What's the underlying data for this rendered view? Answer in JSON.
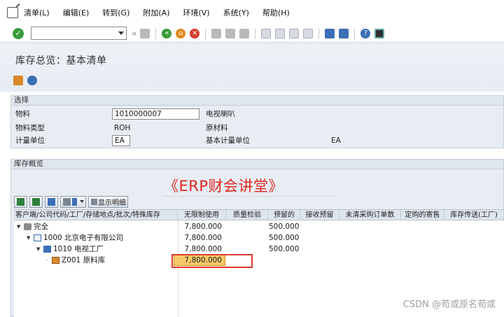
{
  "menu": {
    "items": [
      "清单(L)",
      "编辑(E)",
      "转到(G)",
      "附加(A)",
      "环境(V)",
      "系统(Y)",
      "帮助(H)"
    ]
  },
  "toolbar": {
    "command_value": "",
    "icons": [
      "save-icon",
      "back-icon",
      "exit-icon",
      "cancel-icon",
      "print-icon",
      "find-icon",
      "find-next-icon",
      "first-page-icon",
      "prev-page-icon",
      "next-page-icon",
      "last-page-icon",
      "new-session-icon",
      "shortcut-icon",
      "help-icon",
      "customize-layout-icon"
    ]
  },
  "page": {
    "title": "库存总览：基本清单"
  },
  "selection": {
    "header": "选择",
    "material_label": "物料",
    "material_value": "1010000007",
    "material_desc": "电视喇叭",
    "material_type_label": "物料类型",
    "material_type_value": "ROH",
    "material_type_desc": "原材料",
    "uom_label": "计量单位",
    "uom_value": "EA",
    "base_uom_label": "基本计量单位",
    "base_uom_value": "EA"
  },
  "overview": {
    "header": "库存概览",
    "watermark": "《ERP财会讲堂》",
    "show_details_label": "显示明细",
    "columns": [
      "客户端/公司代码/工厂/存储地点/批次/特殊库存",
      "无限制使用",
      "质量检验",
      "预留的",
      "接收预留",
      "未清采购订单数",
      "定购的寄售",
      "库存传送(工厂)"
    ],
    "rows": [
      {
        "label": "完全",
        "unrestricted": "7,800.000",
        "reserved": "500.000"
      },
      {
        "label": "1000 北京电子有限公司",
        "unrestricted": "7,800.000",
        "reserved": "500.000"
      },
      {
        "label": "1010 电视工厂",
        "unrestricted": "7,800.000",
        "reserved": "500.000"
      },
      {
        "label": "Z001 原料库",
        "unrestricted": "7,800.000",
        "reserved": ""
      }
    ]
  },
  "footer": {
    "csdn": "CSDN @苟或原名苟或"
  },
  "colors": {
    "accent_red": "#e03a2f",
    "highlight": "#f7c96a",
    "sap_blue": "#3b6fb6"
  }
}
